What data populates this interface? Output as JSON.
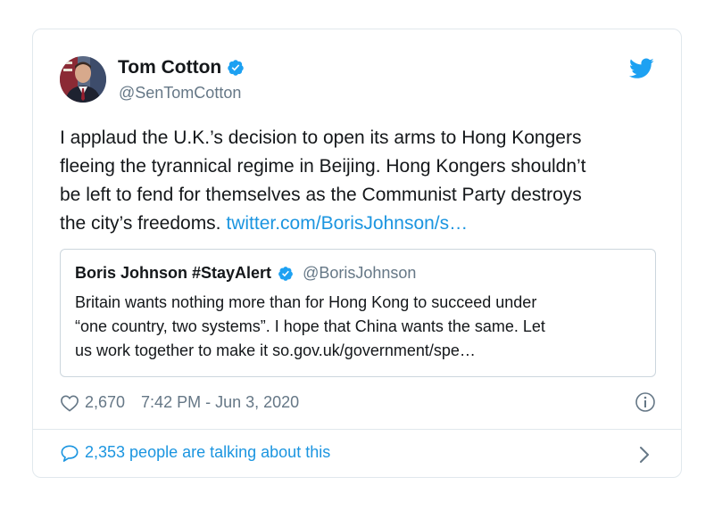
{
  "tweet": {
    "author": {
      "name": "Tom Cotton",
      "handle": "@SenTomCotton",
      "verified": true
    },
    "text_lines": [
      "I applaud the U.K.’s decision to open its arms to Hong Kongers",
      "fleeing the tyrannical regime in Beijing. Hong Kongers shouldn’t",
      "be left to fend for themselves as the Communist Party destroys"
    ],
    "text_last_line": "the city’s freedoms.",
    "link_text": "twitter.com/BorisJohnson/s…",
    "quoted": {
      "name": "Boris Johnson #StayAlert",
      "handle": "@BorisJohnson",
      "verified": true,
      "text_lines": [
        "Britain wants nothing more than for Hong Kong to succeed under",
        "“one country, two systems”. I hope that China wants the same. Let",
        "us work together to make it so.gov.uk/government/spe…"
      ]
    },
    "likes": "2,670",
    "timestamp": "7:42 PM - Jun 3, 2020",
    "talking": "2,353 people are talking about this"
  },
  "icons": {
    "verified": "verified-badge-icon",
    "bird": "twitter-bird-icon",
    "heart": "heart-icon",
    "info": "info-icon",
    "bubble": "speech-bubble-icon",
    "chevron": "chevron-right-icon"
  },
  "colors": {
    "accent": "#1da1f2",
    "link": "#1b95e0",
    "text": "#14171a",
    "secondary": "#657786",
    "border": "#e1e8ed"
  }
}
